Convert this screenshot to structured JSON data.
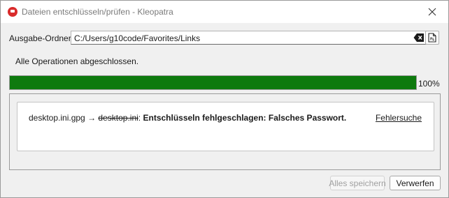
{
  "window": {
    "title": "Dateien entschlüsseln/prüfen - Kleopatra",
    "close_icon": "close-icon",
    "app_icon": "kleopatra-app-icon"
  },
  "output": {
    "label": "Ausgabe-Ordner:",
    "value": "C:/Users/g10code/Favorites/Links",
    "clear_icon": "clear-text-icon",
    "browse_icon": "open-folder-icon"
  },
  "status": {
    "text": "Alle Operationen abgeschlossen."
  },
  "progress": {
    "percent": 100,
    "label": "100%",
    "color": "#0e7a0e"
  },
  "result": {
    "source": "desktop.ini.gpg",
    "arrow": "→",
    "target": "desktop.ini",
    "colon": ":",
    "message": "Entschlüsseln fehlgeschlagen: Falsches Passwort.",
    "details_link": "Fehlersuche"
  },
  "buttons": {
    "save_all": "Alles speichern",
    "discard": "Verwerfen"
  }
}
